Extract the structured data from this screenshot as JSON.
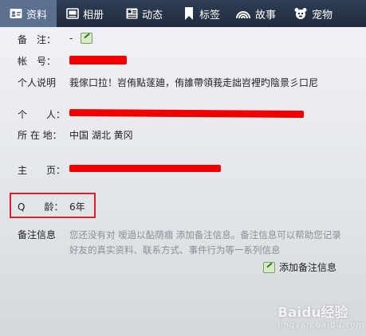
{
  "tabs": [
    {
      "label": "资料",
      "icon": "id-card-icon",
      "active": true
    },
    {
      "label": "相册",
      "icon": "photo-album-icon",
      "active": false
    },
    {
      "label": "动态",
      "icon": "feed-icon",
      "active": false
    },
    {
      "label": "标签",
      "icon": "bookmark-icon",
      "active": false
    },
    {
      "label": "故事",
      "icon": "rainbow-icon",
      "active": false
    },
    {
      "label": "宠物",
      "icon": "pet-icon",
      "active": false
    }
  ],
  "fields": {
    "remark_label": "备　注：",
    "remark_value": "-",
    "account_label": "帐　号：",
    "bio_label": "个人说明",
    "bio_value": "莪傢口拉！岧侑點蓫廸，侑誰帶領莪走詘岧裡旳陰景彡口尼",
    "personal_label": "个　　人：",
    "location_label": "所 在 地：",
    "location_value": "中国 湖北 黄冈",
    "homepage_label": "主　　页：",
    "q_age_label": "Q　　龄：",
    "q_age_value": "6年",
    "note_label": "备注信息"
  },
  "note_text": "您还没有对 嗳過以酟荫痼 添加备注信息。备注信息可以帮助您记录好友的真实资料、联系方式、事件行为等一系列信息",
  "add_note_label": "添加备注信息",
  "watermark": {
    "main": "Baidu经验",
    "sub": "jingyan.baidu.com"
  },
  "colors": {
    "redaction": "#f20000",
    "highlight": "#e02020",
    "tab_bg": "#1f2b3d",
    "tab_active": "#5b6f8f"
  }
}
